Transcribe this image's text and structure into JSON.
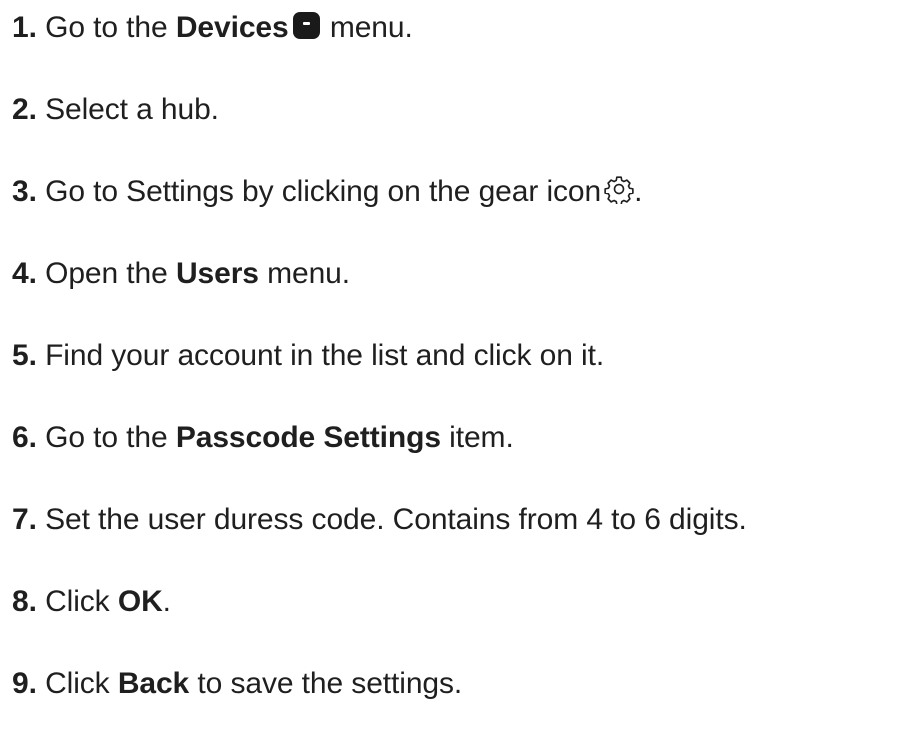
{
  "steps": [
    {
      "num": "1.",
      "pre": "Go to the",
      "bold": "Devices",
      "post": "menu."
    },
    {
      "num": "2.",
      "text": "Select a hub."
    },
    {
      "num": "3.",
      "text": "Go to Settings by clicking on the gear icon",
      "post": "."
    },
    {
      "num": "4.",
      "pre": "Open the",
      "bold": "Users",
      "post": "menu."
    },
    {
      "num": "5.",
      "text": "Find your account in the list and click on it."
    },
    {
      "num": "6.",
      "pre": "Go to the",
      "bold": "Passcode Settings",
      "post": "item."
    },
    {
      "num": "7.",
      "text": "Set the user duress code. Contains from 4 to 6 digits."
    },
    {
      "num": "8.",
      "pre": "Click",
      "bold": "OK",
      "post": "."
    },
    {
      "num": "9.",
      "pre": "Click",
      "bold": "Back",
      "post": "to save the settings."
    }
  ],
  "icons": {
    "devices": "devices-icon",
    "gear": "gear-icon"
  }
}
